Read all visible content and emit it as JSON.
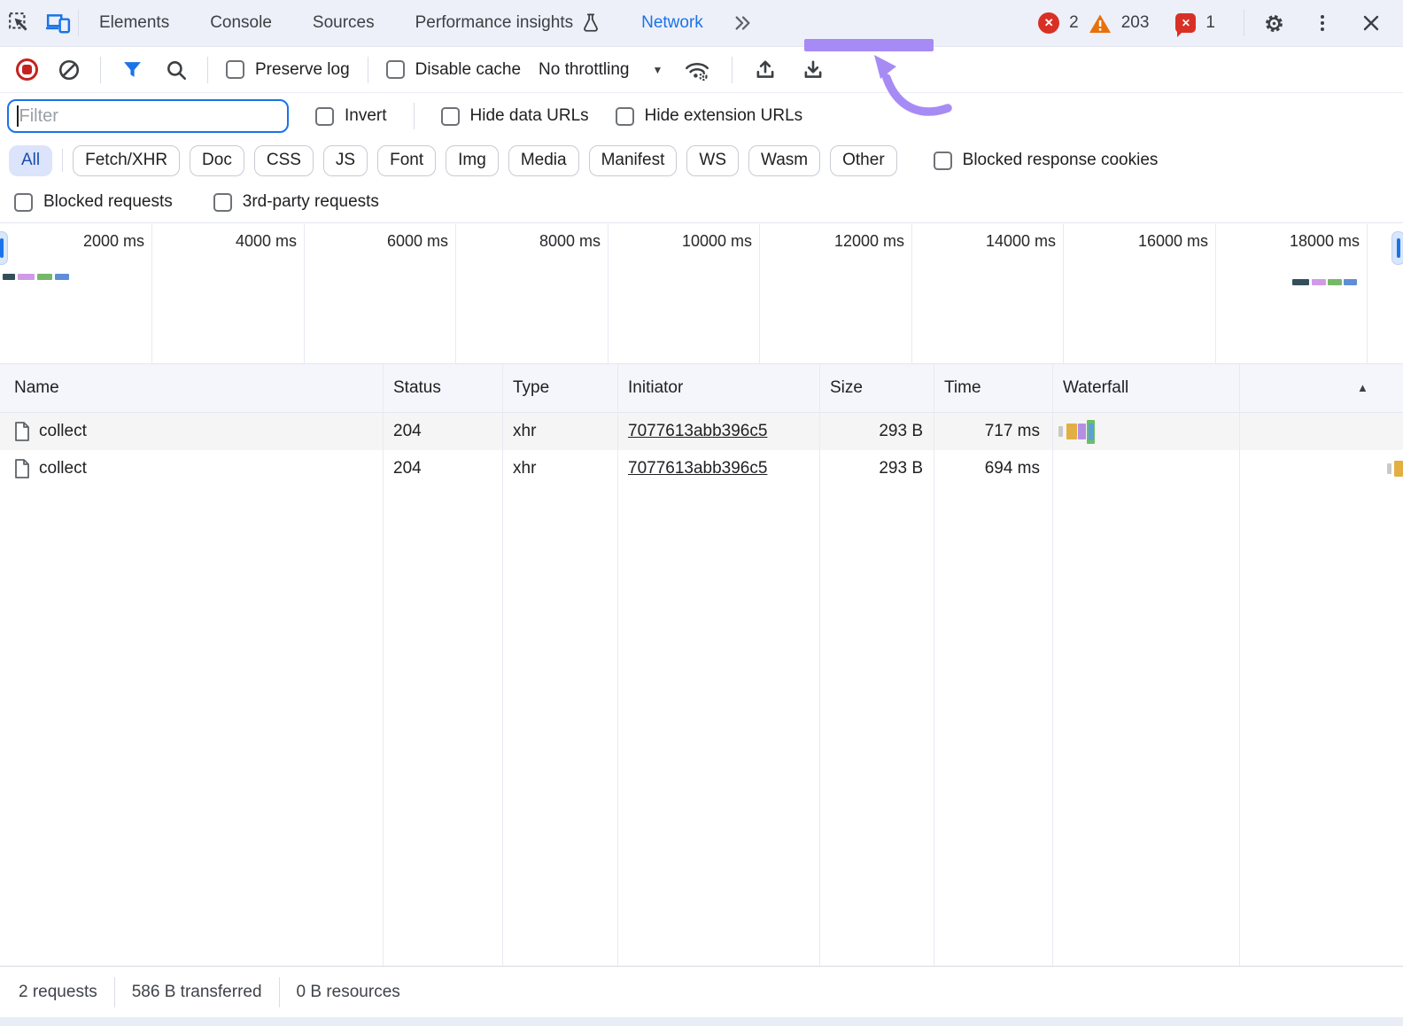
{
  "main_tabs": {
    "elements": "Elements",
    "console": "Console",
    "sources": "Sources",
    "performance_insights": "Performance insights",
    "network": "Network",
    "error_count": "2",
    "warning_count": "203",
    "issue_count": "1"
  },
  "toolbar": {
    "preserve_log": "Preserve log",
    "disable_cache": "Disable cache",
    "throttling": "No throttling"
  },
  "filter_bar": {
    "placeholder": "Filter",
    "invert": "Invert",
    "hide_data_urls": "Hide data URLs",
    "hide_extension_urls": "Hide extension URLs",
    "blocked_response_cookies": "Blocked response cookies",
    "blocked_requests": "Blocked requests",
    "third_party_requests": "3rd-party requests"
  },
  "chips": [
    "All",
    "Fetch/XHR",
    "Doc",
    "CSS",
    "JS",
    "Font",
    "Img",
    "Media",
    "Manifest",
    "WS",
    "Wasm",
    "Other"
  ],
  "timeline": {
    "ticks": [
      "2000 ms",
      "4000 ms",
      "6000 ms",
      "8000 ms",
      "10000 ms",
      "12000 ms",
      "14000 ms",
      "16000 ms",
      "18000 ms"
    ]
  },
  "table": {
    "columns": [
      "Name",
      "Status",
      "Type",
      "Initiator",
      "Size",
      "Time",
      "Waterfall"
    ],
    "rows": [
      {
        "name": "collect",
        "status": "204",
        "type": "xhr",
        "initiator": "7077613abb396c5",
        "size": "293 B",
        "time": "717 ms"
      },
      {
        "name": "collect",
        "status": "204",
        "type": "xhr",
        "initiator": "7077613abb396c5",
        "size": "293 B",
        "time": "694 ms"
      }
    ]
  },
  "status_bar": {
    "requests": "2 requests",
    "transferred": "586 B transferred",
    "resources": "0 B resources"
  },
  "colors": {
    "accent": "#1a73e8",
    "annotation": "#a78bf5",
    "error": "#d93025",
    "warning": "#e8710a",
    "selected_chip_bg": "#dbe4fb"
  }
}
